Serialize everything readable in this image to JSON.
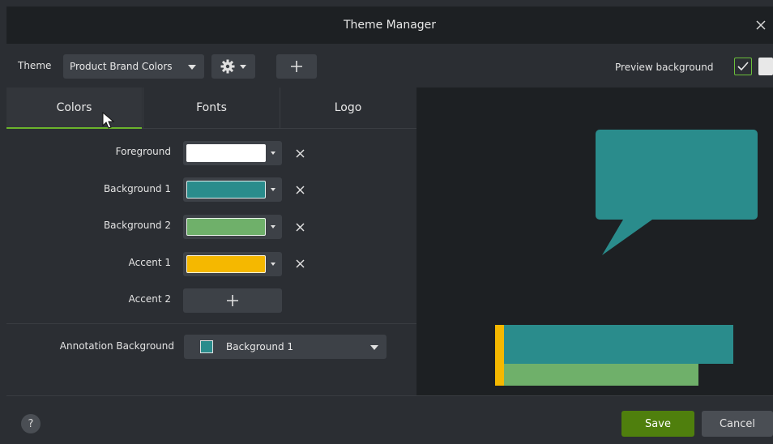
{
  "window": {
    "title": "Theme Manager",
    "close_icon": "close-icon"
  },
  "toolbar": {
    "theme_label": "Theme",
    "theme_value": "Product Brand Colors",
    "gear_icon": "gear-icon",
    "add_icon": "plus-icon",
    "preview_label": "Preview background",
    "preview_checked": true
  },
  "tabs": [
    {
      "label": "Colors",
      "active": true
    },
    {
      "label": "Fonts",
      "active": false
    },
    {
      "label": "Logo",
      "active": false
    }
  ],
  "colors": [
    {
      "label": "Foreground",
      "color": "#ffffff"
    },
    {
      "label": "Background 1",
      "color": "#2a8c8c"
    },
    {
      "label": "Background 2",
      "color": "#6fb06a"
    },
    {
      "label": "Accent 1",
      "color": "#f5b800"
    }
  ],
  "accent2": {
    "label": "Accent 2"
  },
  "annotation": {
    "label": "Annotation Background",
    "value": "Background 1",
    "swatch": "#2a8c8c"
  },
  "footer": {
    "help": "?",
    "save": "Save",
    "cancel": "Cancel"
  },
  "palette": {
    "accent": "#4f7f0d",
    "teal": "#2a8c8c",
    "green": "#6fb06a",
    "yellow": "#f5b800"
  }
}
